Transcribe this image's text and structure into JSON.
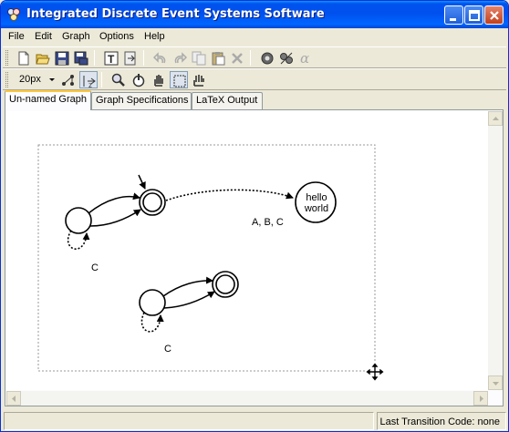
{
  "window": {
    "title": "Integrated Discrete Event Systems Software",
    "icon": "ides-app-icon"
  },
  "menu": {
    "items": [
      "File",
      "Edit",
      "Graph",
      "Options",
      "Help"
    ]
  },
  "toolbar1": {
    "icons": [
      "new-file-icon",
      "open-folder-icon",
      "save-icon",
      "save-all-icon",
      "text-tool-icon",
      "export-icon",
      "undo-icon",
      "redo-icon",
      "copy-icon",
      "paste-icon",
      "delete-icon",
      "operations-icon",
      "ides-tools-icon",
      "alpha-icon"
    ],
    "alpha_glyph": "α"
  },
  "toolbar2": {
    "zoom_value": "20px",
    "icons": [
      "graph-layout-icon",
      "align-tool-icon",
      "zoom-tool-icon",
      "create-tool-icon",
      "hand-tool-icon",
      "select-tool-icon",
      "move-tool-icon"
    ]
  },
  "tabs": [
    "Un-named Graph",
    "Graph Specifications",
    "LaTeX Output"
  ],
  "graph": {
    "state_hello_line1": "hello",
    "state_hello_line2": "world",
    "edge_labels": {
      "main": "A, B, C",
      "self_loop_1": "C",
      "self_loop_2": "C"
    }
  },
  "status": {
    "last_transition_label": "Last Transition Code:",
    "last_transition_value": "none"
  }
}
